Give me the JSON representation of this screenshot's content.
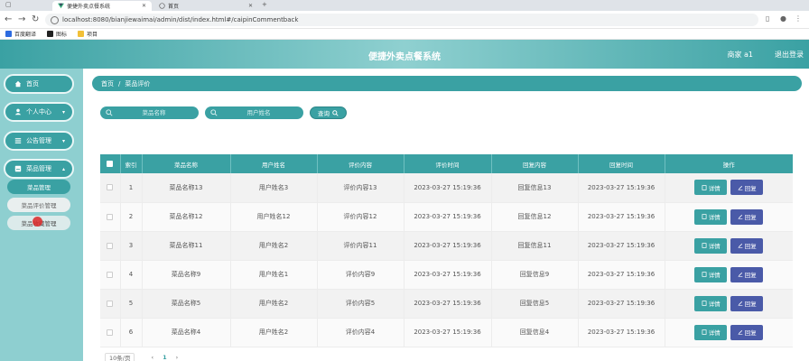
{
  "browser": {
    "tabs": [
      {
        "label": "便捷外卖点餐系统",
        "active": true
      },
      {
        "label": "首页",
        "active": false
      }
    ],
    "new_tab": "+",
    "url": "localhost:8080/bianjiewaimai/admin/dist/index.html#/caipinCommentback",
    "bookmarks": [
      "百度翻译",
      "图标",
      "项目"
    ]
  },
  "header": {
    "title": "便捷外卖点餐系统",
    "user": "商家 a1",
    "logout": "退出登录"
  },
  "sidebar": {
    "items": [
      {
        "label": "首页",
        "icon": "home-icon"
      },
      {
        "label": "个人中心",
        "icon": "user-icon"
      },
      {
        "label": "公告管理",
        "icon": "list-icon"
      },
      {
        "label": "菜品管理",
        "icon": "menu-icon"
      }
    ],
    "subitems": [
      "菜品管理",
      "菜品评价管理",
      "菜品收藏管理"
    ]
  },
  "breadcrumb": {
    "home": "首页",
    "separator": "/",
    "current": "菜品评价"
  },
  "search": {
    "dish_placeholder": "菜品名称",
    "user_placeholder": "用户姓名",
    "button": "查询"
  },
  "table": {
    "headers": [
      "索引",
      "菜品名称",
      "用户姓名",
      "评价内容",
      "评价时间",
      "回复内容",
      "回复时间",
      "操作"
    ],
    "detail_label": "详情",
    "reply_label": "回复",
    "rows": [
      {
        "index": "1",
        "dish": "菜品名称13",
        "user": "用户姓名3",
        "content": "评价内容13",
        "time": "2023-03-27 15:19:36",
        "reply": "回复信息13",
        "reply_time": "2023-03-27 15:19:36"
      },
      {
        "index": "2",
        "dish": "菜品名称12",
        "user": "用户姓名12",
        "content": "评价内容12",
        "time": "2023-03-27 15:19:36",
        "reply": "回复信息12",
        "reply_time": "2023-03-27 15:19:36"
      },
      {
        "index": "3",
        "dish": "菜品名称11",
        "user": "用户姓名2",
        "content": "评价内容11",
        "time": "2023-03-27 15:19:36",
        "reply": "回复信息11",
        "reply_time": "2023-03-27 15:19:36"
      },
      {
        "index": "4",
        "dish": "菜品名称9",
        "user": "用户姓名1",
        "content": "评价内容9",
        "time": "2023-03-27 15:19:36",
        "reply": "回复信息9",
        "reply_time": "2023-03-27 15:19:36"
      },
      {
        "index": "5",
        "dish": "菜品名称5",
        "user": "用户姓名2",
        "content": "评价内容5",
        "time": "2023-03-27 15:19:36",
        "reply": "回复信息5",
        "reply_time": "2023-03-27 15:19:36"
      },
      {
        "index": "6",
        "dish": "菜品名称4",
        "user": "用户姓名2",
        "content": "评价内容4",
        "time": "2023-03-27 15:19:36",
        "reply": "回复信息4",
        "reply_time": "2023-03-27 15:19:36"
      }
    ]
  },
  "pagination": {
    "page_size": "10条/页",
    "prev": "‹",
    "current": "1",
    "next": "›"
  },
  "colors": {
    "primary": "#3aa1a3",
    "sidebar_bg": "#8ecfd0",
    "reply_button": "#4a5aa8"
  }
}
